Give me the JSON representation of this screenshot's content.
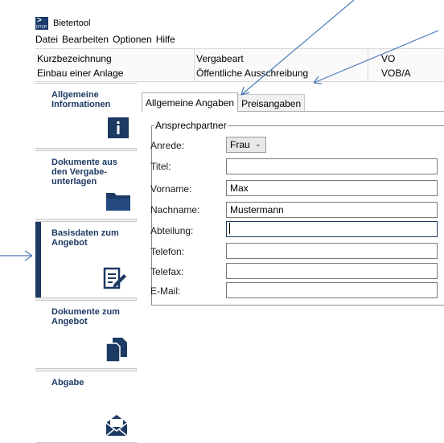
{
  "app": {
    "title": "Bietertool",
    "logo_text": "DTVP"
  },
  "menu": [
    "Datei",
    "Bearbeiten",
    "Optionen",
    "Hilfe"
  ],
  "info": {
    "col1_label": "Kurzbezeichnung",
    "col1_value": "Einbau einer Anlage",
    "col2_label": "Vergabeart",
    "col2_value": "Öffentliche Ausschreibung",
    "col3_label": "VO",
    "col3_value": "VOB/A"
  },
  "sidebar": {
    "items": [
      {
        "label": "Allgemeine Informationen",
        "icon": "info-icon",
        "active": false
      },
      {
        "label": "Dokumente aus den Vergabe-unterlagen",
        "icon": "folder-icon",
        "active": false
      },
      {
        "label": "Basisdaten zum Angebot",
        "icon": "edit-document-icon",
        "active": true
      },
      {
        "label": "Dokumente zum Angebot",
        "icon": "documents-icon",
        "active": false
      },
      {
        "label": "Abgabe",
        "icon": "envelope-icon",
        "active": false
      }
    ]
  },
  "tabs": [
    {
      "label": "Allgemeine Angaben",
      "active": true
    },
    {
      "label": "Preisangaben",
      "active": false
    }
  ],
  "contact": {
    "legend": "Ansprechpartner",
    "anrede_label": "Anrede:",
    "anrede_value": "Frau",
    "titel_label": "Titel:",
    "titel_value": "",
    "vorname_label": "Vorname:",
    "vorname_value": "Max",
    "nachname_label": "Nachname:",
    "nachname_value": "Mustermann",
    "abteilung_label": "Abteilung:",
    "abteilung_value": "",
    "telefon_label": "Telefon:",
    "telefon_value": "",
    "telefax_label": "Telefax:",
    "telefax_value": "",
    "email_label": "E-Mail:",
    "email_value": ""
  },
  "colors": {
    "accent": "#1d3a64",
    "annotation": "#4a78b8"
  }
}
